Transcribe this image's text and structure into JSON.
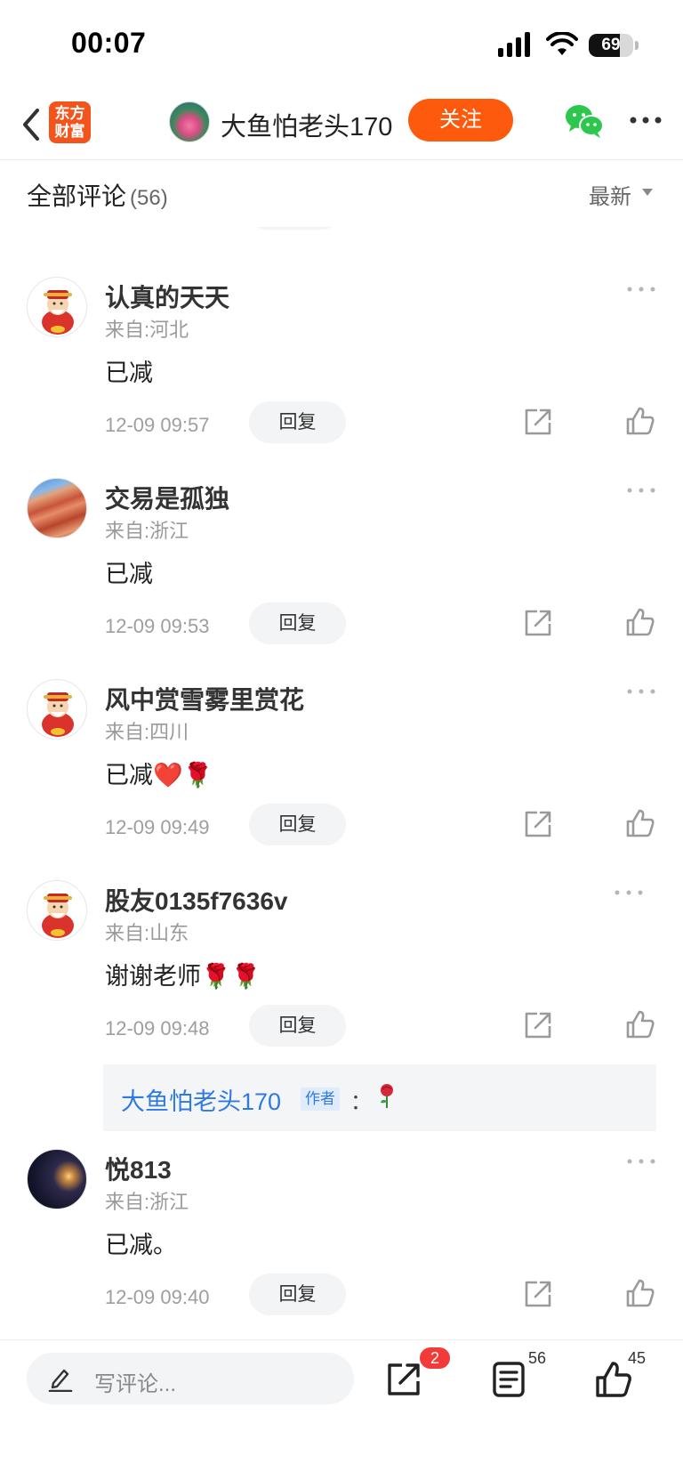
{
  "status_bar": {
    "time": "00:07",
    "battery_level": "69"
  },
  "nav": {
    "logo_line1": "东方",
    "logo_line2": "财富",
    "title": "大鱼怕老头170",
    "follow_label": "关注",
    "accent_color": "#fe5a0e"
  },
  "sort": {
    "title": "全部评论",
    "count": "(56)",
    "selected": "最新"
  },
  "comments": [
    {
      "username": "认真的天天",
      "location": "来自:河北",
      "text": "已减",
      "time": "12-09 09:57",
      "reply_label": "回复"
    },
    {
      "username": "交易是孤独",
      "location": "来自:浙江",
      "text": "已减",
      "time": "12-09 09:53",
      "reply_label": "回复"
    },
    {
      "username": "风中赏雪雾里赏花",
      "location": "来自:四川",
      "text": "已减❤️🌹",
      "time": "12-09 09:49",
      "reply_label": "回复"
    },
    {
      "username": "股友0135f7636v",
      "location": "来自:山东",
      "text": "谢谢老师🌹🌹",
      "time": "12-09 09:48",
      "reply_label": "回复",
      "author_reply": {
        "name": "大鱼怕老头170",
        "badge": "作者",
        "colon": "：",
        "emoji": "rose-icon"
      }
    },
    {
      "username": "悦813",
      "location": "来自:浙江",
      "text": "已减。",
      "time": "12-09 09:40",
      "reply_label": "回复"
    }
  ],
  "bottom_bar": {
    "input_placeholder": "写评论...",
    "share_badge": "2",
    "comment_count": "56",
    "like_count": "45"
  }
}
